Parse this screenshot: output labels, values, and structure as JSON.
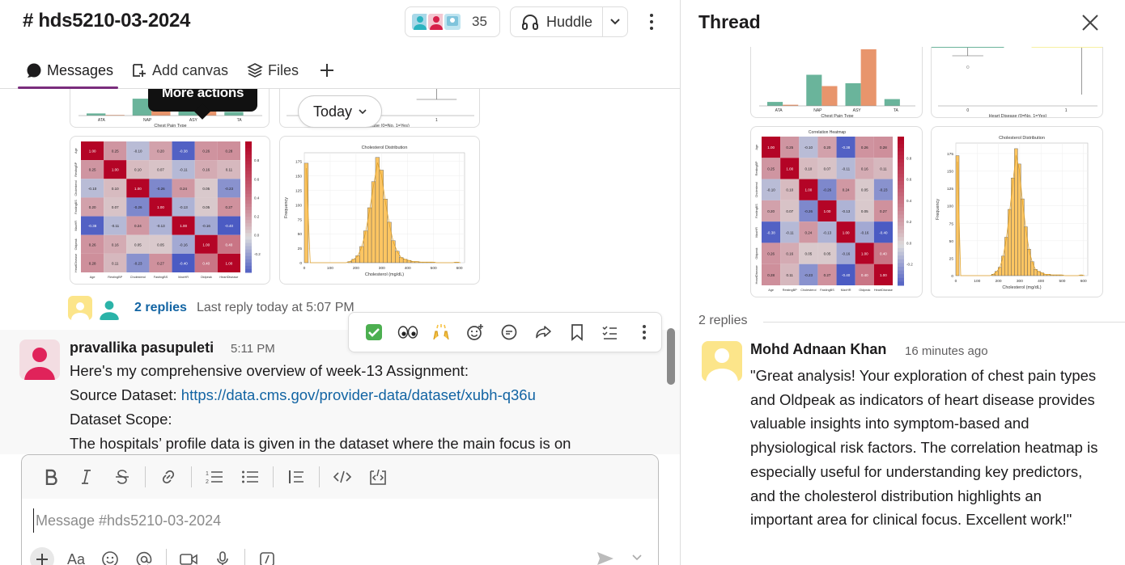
{
  "channel": {
    "title": "# hds5210-03-2024",
    "member_count": "35",
    "huddle_label": "Huddle",
    "tabs": [
      {
        "label": "Messages",
        "active": true
      },
      {
        "label": "Add canvas",
        "active": false
      },
      {
        "label": "Files",
        "active": false
      }
    ],
    "tooltip": "More actions",
    "date_pill": "Today",
    "thread_summary": {
      "replies_link": "2 replies",
      "last_reply": "Last reply today at 5:07 PM"
    },
    "message": {
      "author": "pravallika pasupuleti",
      "time": "5:11 PM",
      "line1": "Here's my comprehensive overview of week-13 Assignment:",
      "source_label": "Source Dataset:",
      "source_url": "https://data.cms.gov/provider-data/dataset/xubh-q36u",
      "line3": "Dataset Scope:",
      "line4": "The hospitals’ profile data is given in the dataset where the main focus is on"
    },
    "composer": {
      "placeholder": "Message #hds5210-03-2024",
      "font_button": "Aa"
    }
  },
  "thread": {
    "title": "Thread",
    "replies_count": "2 replies",
    "reply": {
      "author": "Mohd Adnaan Khan",
      "time": "16 minutes ago",
      "text": "\"Great analysis! Your exploration of chest pain types and Oldpeak as indicators of heart disease provides valuable insights into symptom-based and physiological risk factors. The correlation heatmap is especially useful for understanding key predictors, and the cholesterol distribution highlights an important area for clinical focus. Excellent work!\""
    }
  },
  "charts": {
    "chest_pain": {
      "xlabel": "Chest Pain Type",
      "categories": [
        "ATA",
        "NAP",
        "ASY",
        "TA"
      ],
      "colors": [
        "#6ab49b",
        "#e8956c"
      ]
    },
    "boxplot": {
      "xlabel": "Heart Disease (0=No, 1=Yes)",
      "ticks": [
        "0",
        "1"
      ]
    },
    "heatmap": {
      "title": "Correlation Heatmap",
      "labels": [
        "Age",
        "RestingBP",
        "Cholesterol",
        "FastingBS",
        "MaxHR",
        "Oldpeak",
        "HeartDisease"
      ],
      "values": [
        [
          1.0,
          0.25,
          -0.1,
          0.2,
          -0.38,
          0.26,
          0.28
        ],
        [
          0.25,
          1.0,
          0.1,
          0.07,
          -0.11,
          0.16,
          0.11
        ],
        [
          -0.1,
          0.1,
          1.0,
          -0.26,
          0.24,
          0.05,
          -0.23
        ],
        [
          0.2,
          0.07,
          -0.26,
          1.0,
          -0.13,
          0.05,
          0.27
        ],
        [
          -0.38,
          -0.11,
          0.24,
          -0.13,
          1.0,
          -0.16,
          -0.4
        ],
        [
          0.26,
          0.16,
          0.05,
          0.05,
          -0.16,
          1.0,
          0.4
        ],
        [
          0.28,
          0.11,
          -0.23,
          0.27,
          -0.4,
          0.4,
          1.0
        ]
      ],
      "colorbar_ticks": [
        "0.8",
        "0.6",
        "0.4",
        "0.2",
        "0.0",
        "-0.2"
      ]
    },
    "cholesterol": {
      "title": "Cholesterol Distribution",
      "xlabel": "Cholesterol (mg/dL)",
      "ylabel": "Frequency",
      "x_ticks": [
        "0",
        "100",
        "200",
        "300",
        "400",
        "500",
        "600"
      ],
      "y_ticks": [
        "0",
        "25",
        "50",
        "75",
        "100",
        "125",
        "150",
        "175"
      ],
      "bar_color": "#fcc562",
      "bins": [
        172,
        0,
        0,
        0,
        0,
        0,
        0,
        0,
        0,
        0,
        0,
        2,
        6,
        12,
        28,
        55,
        95,
        140,
        182,
        160,
        110,
        70,
        38,
        20,
        9,
        6,
        4,
        2,
        2,
        1,
        1,
        1,
        1,
        0,
        0,
        0,
        0,
        0,
        1,
        0
      ]
    }
  }
}
